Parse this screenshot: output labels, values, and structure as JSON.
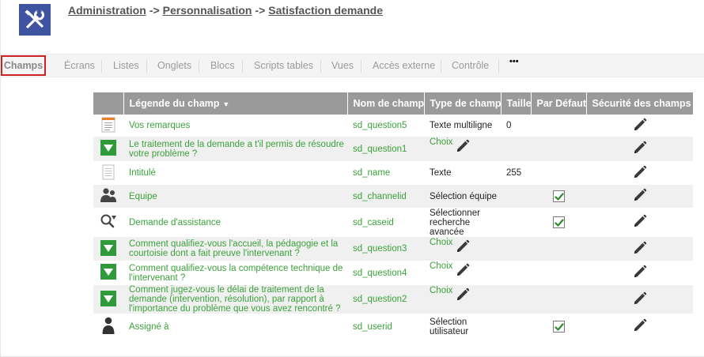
{
  "breadcrumb": {
    "items": [
      "Administration",
      "Personnalisation",
      "Satisfaction demande"
    ],
    "separator": "->"
  },
  "tabs": [
    "Champs",
    "Écrans",
    "Listes",
    "Onglets",
    "Blocs",
    "Scripts tables",
    "Vues",
    "Accès externe",
    "Contrôle",
    "•••"
  ],
  "active_tab": "Champs",
  "table": {
    "headers": [
      "",
      "Légende du champ",
      "Nom de champ",
      "Type de champ",
      "Taille",
      "Par Défaut",
      "Sécurité des champs"
    ],
    "sorted_column": "Légende du champ",
    "rows": [
      {
        "icon": "textarea-icon",
        "legend": "Vos remarques",
        "name": "sd_question5",
        "type": "Texte multiligne",
        "type_style": "text",
        "size": "0",
        "default_checked": false,
        "edit_type": false
      },
      {
        "icon": "green-choice-icon",
        "legend": "Le traitement de la demande a t'il permis de résoudre votre problème ?",
        "name": "sd_question1",
        "type": "Choix",
        "type_style": "choice",
        "size": "",
        "default_checked": false,
        "edit_type": true
      },
      {
        "icon": "text-field-icon",
        "legend": "Intitulé",
        "name": "sd_name",
        "type": "Texte",
        "type_style": "text",
        "size": "255",
        "default_checked": false,
        "edit_type": false
      },
      {
        "icon": "team-icon",
        "legend": "Equipe",
        "name": "sd_channelid",
        "type": "Sélection équipe",
        "type_style": "text",
        "size": "",
        "default_checked": true,
        "edit_type": false
      },
      {
        "icon": "advanced-search-icon",
        "legend": "Demande d'assistance",
        "name": "sd_caseid",
        "type": "Sélectionner recherche avancée",
        "type_style": "text",
        "size": "",
        "default_checked": true,
        "edit_type": false
      },
      {
        "icon": "green-choice-icon",
        "legend": "Comment qualifiez-vous l'accueil, la pédagogie et la courtoisie dont a fait preuve l'intervenant ?",
        "name": "sd_question3",
        "type": "Choix",
        "type_style": "choice",
        "size": "",
        "default_checked": false,
        "edit_type": true
      },
      {
        "icon": "green-choice-icon",
        "legend": "Comment qualifiez-vous la compétence technique de l'intervenant ?",
        "name": "sd_question4",
        "type": "Choix",
        "type_style": "choice",
        "size": "",
        "default_checked": false,
        "edit_type": true
      },
      {
        "icon": "green-choice-icon",
        "legend": "Comment jugez-vous le délai de traitement de la demande (intervention, résolution), par rapport à l'importance du problème que vous avez rencontré ?",
        "name": "sd_question2",
        "type": "Choix",
        "type_style": "choice",
        "size": "",
        "default_checked": false,
        "edit_type": true
      },
      {
        "icon": "user-icon",
        "legend": "Assigné à",
        "name": "sd_userid",
        "type": "Sélection utilisateur",
        "type_style": "text",
        "size": "",
        "default_checked": true,
        "edit_type": false
      }
    ]
  },
  "colors": {
    "header_bg": "#9a9a9a",
    "link_green": "#3aa23a",
    "choice_green": "#2f9a3a",
    "logo_bg": "#3f54a0",
    "active_tab_border": "#cc2222"
  }
}
